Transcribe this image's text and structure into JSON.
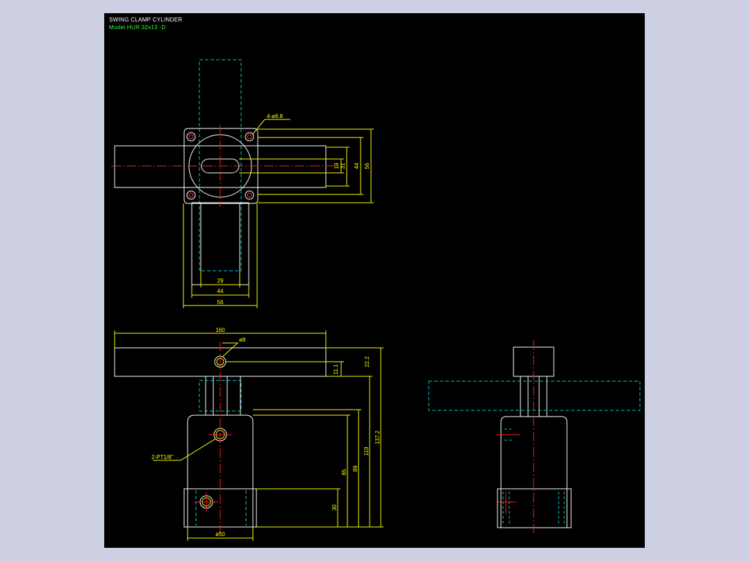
{
  "drawing": {
    "title": "SWING CLAMP CYLINDER",
    "model": "Model  HUR 32x13 -D"
  },
  "dimensions": {
    "top_holes": "4-ø6.8",
    "top_h19": "19",
    "top_h31": "31",
    "top_h44": "44",
    "top_h56": "56",
    "top_w29": "29",
    "top_w44": "44",
    "top_w56": "56",
    "front_160": "160",
    "front_d8": "ø8",
    "front_11": "11.1",
    "front_222": "22.2",
    "front_1372": "137.2",
    "front_119": "119",
    "front_89": "89",
    "front_85": "85",
    "front_30": "30",
    "front_port": "2-PT1/8\"",
    "front_d50": "ø50"
  },
  "colors": {
    "background": "#000000",
    "outline": "#ffffff",
    "dimension": "#ffff00",
    "hidden": "#00cccc",
    "center": "#ff2020",
    "model_text": "#33ff33"
  }
}
